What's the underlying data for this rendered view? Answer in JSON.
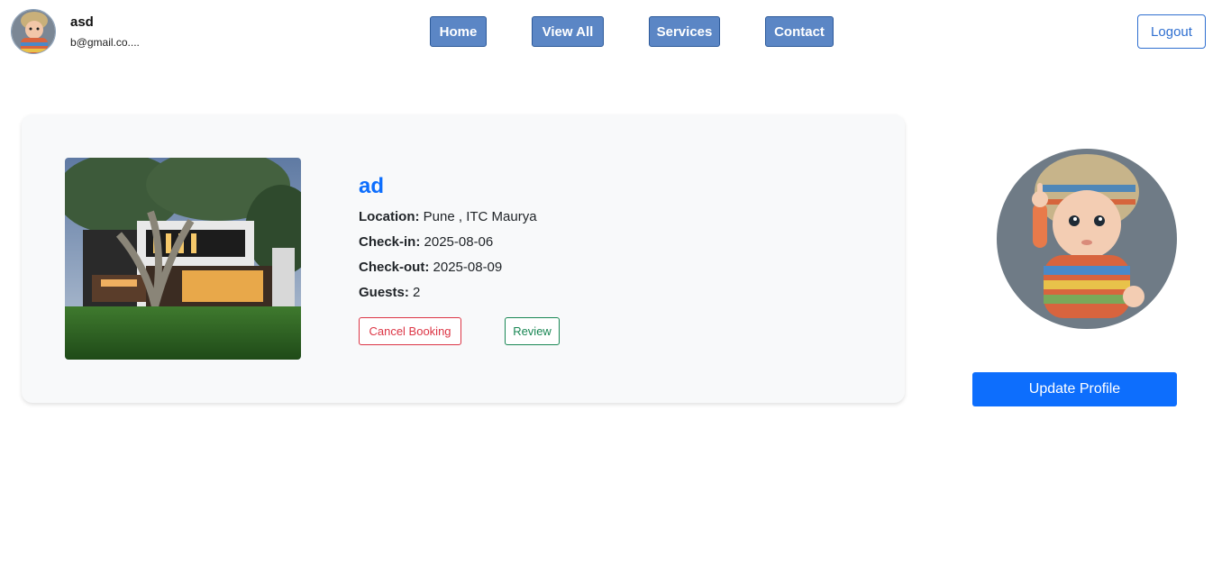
{
  "user": {
    "name": "asd",
    "email": "b@gmail.co...."
  },
  "nav": {
    "home": "Home",
    "view_all": "View All",
    "services": "Services",
    "contact": "Contact",
    "logout": "Logout"
  },
  "booking": {
    "title": "ad",
    "location_label": "Location:",
    "location_value": "Pune , ITC Maurya",
    "checkin_label": "Check-in:",
    "checkin_value": "2025-08-06",
    "checkout_label": "Check-out:",
    "checkout_value": "2025-08-09",
    "guests_label": "Guests:",
    "guests_value": "2",
    "cancel_label": "Cancel Booking",
    "review_label": "Review"
  },
  "profile": {
    "update_label": "Update Profile"
  },
  "colors": {
    "nav_button": "#5b86c5",
    "primary": "#0d6efd",
    "danger": "#dc3545",
    "success": "#198754",
    "card_bg": "#f8f9fa"
  },
  "icons": {
    "avatar": "baby-avatar-image",
    "property": "house-photo"
  }
}
